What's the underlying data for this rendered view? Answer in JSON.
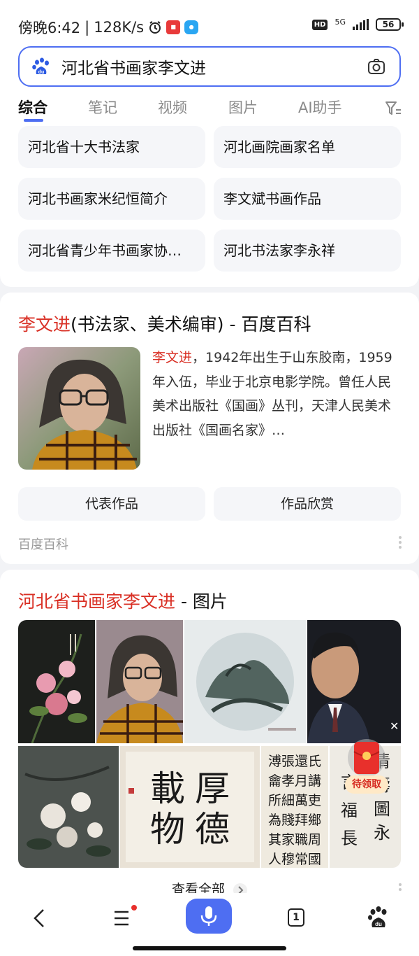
{
  "status_bar": {
    "time": "傍晚6:42",
    "speed": "128K/s",
    "network": "5G",
    "battery": "56",
    "hd": "HD"
  },
  "search": {
    "query": "河北省书画家李文进"
  },
  "tabs": [
    {
      "label": "综合",
      "active": true
    },
    {
      "label": "笔记"
    },
    {
      "label": "视频"
    },
    {
      "label": "图片"
    },
    {
      "label": "AI助手"
    }
  ],
  "related_searches": [
    "河北省十大书法家",
    "河北画院画家名单",
    "河北书画家米纪恒简介",
    "李文斌书画作品",
    "河北省青少年书画家协…",
    "河北书法家李永祥"
  ],
  "baike": {
    "title_highlight": "李文进",
    "title_rest": "(书法家、美术编审) - 百度百科",
    "desc_highlight": "李文进",
    "desc_rest": "，1942年出生于山东胶南，1959年入伍，毕业于北京电影学院。曾任人民美术出版社《国画》丛刊，天津人民美术出版社《国画名家》…",
    "buttons": [
      "代表作品",
      "作品欣赏"
    ],
    "source": "百度百科"
  },
  "images_card": {
    "title_highlight": "河北省书画家李文进",
    "title_rest": " - 图片",
    "view_all": "查看全部",
    "calligraphy_1": "厚德载物",
    "calligraphy_2": "溥張還氏",
    "calligraphy_3": "寿"
  },
  "red_packet": {
    "label": "待领取"
  },
  "bottom_nav": {
    "tabs_count": "1"
  },
  "colors": {
    "accent": "#4e6ef2",
    "highlight": "#d93025"
  }
}
